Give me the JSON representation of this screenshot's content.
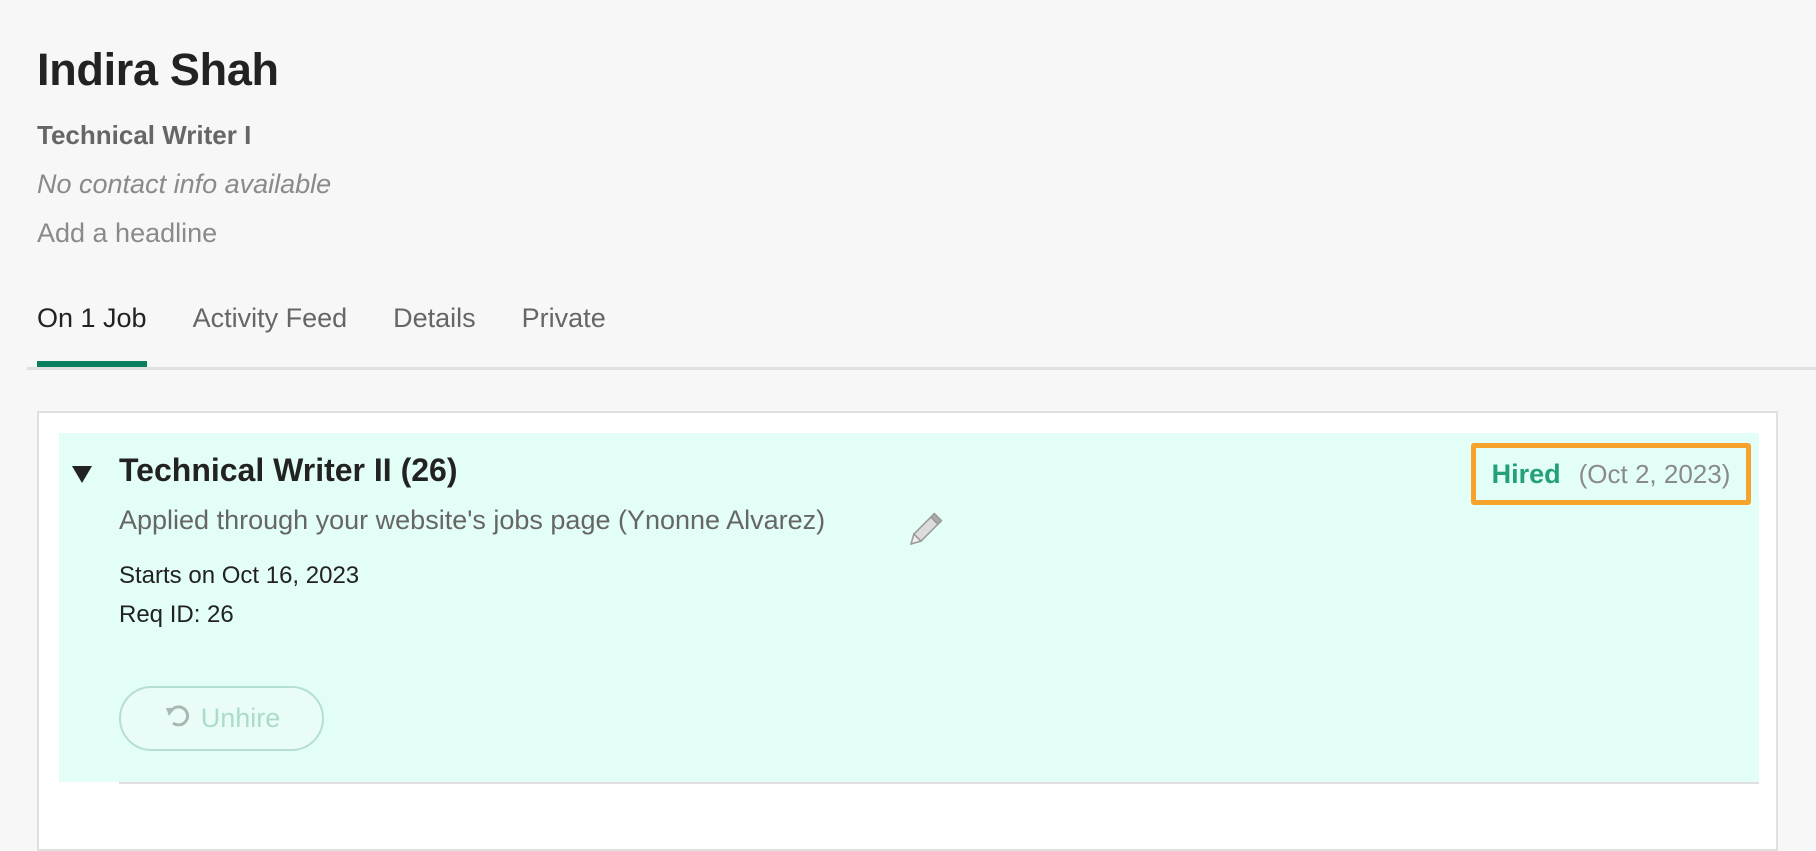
{
  "candidate": {
    "name": "Indira Shah",
    "current_role": "Technical Writer I",
    "contact": "No contact info available",
    "headline_link": "Add a headline"
  },
  "tabs": [
    {
      "label": "On 1 Job",
      "active": true
    },
    {
      "label": "Activity Feed",
      "active": false
    },
    {
      "label": "Details",
      "active": false
    },
    {
      "label": "Private",
      "active": false
    }
  ],
  "job": {
    "title": "Technical Writer II (26)",
    "source": "Applied through your website's jobs page (Ynonne Alvarez)",
    "starts": "Starts on Oct 16, 2023",
    "req_id": "Req ID: 26",
    "status": "Hired",
    "status_date": "(Oct 2, 2023)",
    "unhire_label": "Unhire",
    "icons": {
      "expand": "caret-down-icon",
      "edit": "pencil-icon",
      "unhire": "undo-icon"
    }
  },
  "colors": {
    "accent": "#0b7f5e",
    "hired": "#22a07b",
    "highlight_box": "#f5a32a",
    "job_panel_bg": "#e3fdf7"
  }
}
